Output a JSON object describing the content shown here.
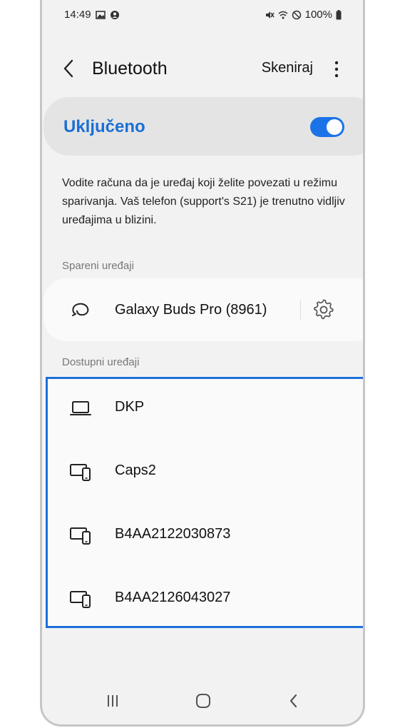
{
  "status_bar": {
    "time": "14:49",
    "battery": "100%"
  },
  "header": {
    "title": "Bluetooth",
    "scan_label": "Skeniraj"
  },
  "toggle": {
    "label": "Uključeno",
    "state": "on"
  },
  "info_text": "Vodite računa da je uređaj koji želite povezati u režimu sparivanja. Vaš telefon (support's S21) je trenutno vidljiv uređajima u blizini.",
  "paired": {
    "section_label": "Spareni uređaji",
    "devices": [
      {
        "name": "Galaxy Buds Pro (8961)",
        "icon": "earbuds-icon"
      }
    ]
  },
  "available": {
    "section_label": "Dostupni uređaji",
    "devices": [
      {
        "name": "DKP",
        "icon": "laptop-icon"
      },
      {
        "name": "Caps2",
        "icon": "devices-icon"
      },
      {
        "name": "B4AA2122030873",
        "icon": "devices-icon"
      },
      {
        "name": "B4AA2126043027",
        "icon": "devices-icon"
      }
    ]
  },
  "colors": {
    "accent": "#1b73e8",
    "highlight": "#1e6fd9"
  }
}
